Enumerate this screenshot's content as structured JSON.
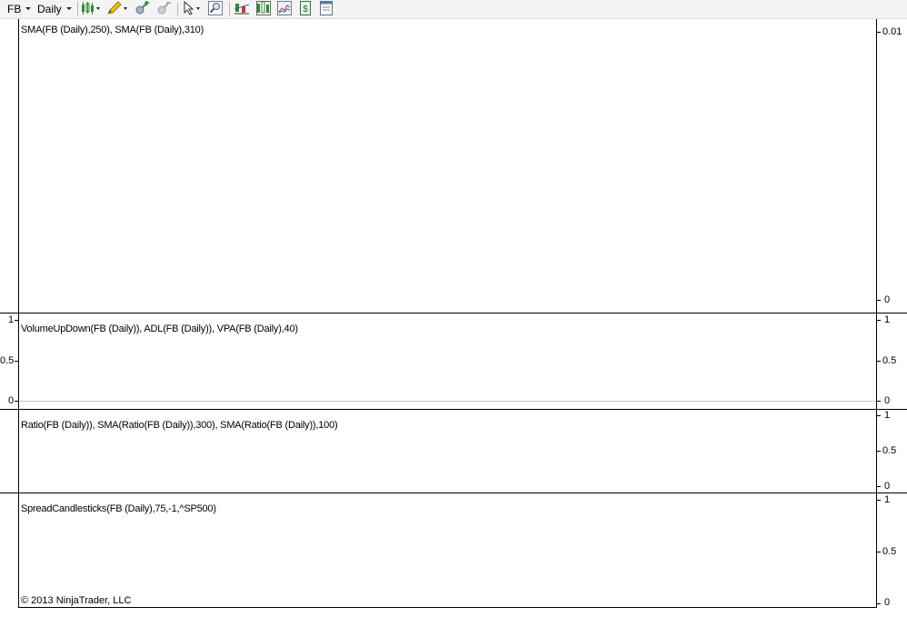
{
  "toolbar": {
    "instrument": "FB",
    "period": "Daily",
    "icons": [
      "chart-style-icon",
      "drawing-pencil-icon",
      "zoom-in-icon",
      "zoom-out-icon",
      "cursor-icon",
      "magnify-icon",
      "indicators-icon",
      "strategies-icon",
      "chart-properties-icon",
      "data-box-icon",
      "template-icon"
    ]
  },
  "panels": [
    {
      "label": "SMA(FB (Daily),250), SMA(FB (Daily),310)",
      "right_ticks": [
        "0.01",
        "0"
      ]
    },
    {
      "label": "VolumeUpDown(FB (Daily)), ADL(FB (Daily)), VPA(FB (Daily),40)",
      "left_ticks": [
        "1",
        "0.5",
        "0"
      ],
      "right_ticks": [
        "1",
        "0.5",
        "0"
      ]
    },
    {
      "label": "Ratio(FB (Daily)), SMA(Ratio(FB (Daily)),300), SMA(Ratio(FB (Daily)),100)",
      "right_ticks": [
        "1",
        "0.5",
        "0"
      ]
    },
    {
      "label": "SpreadCandlesticks(FB (Daily),75,-1,^SP500)",
      "right_ticks": [
        "1",
        "0.5",
        "0"
      ]
    }
  ],
  "footer": {
    "copyright": "© 2013 NinjaTrader, LLC"
  }
}
